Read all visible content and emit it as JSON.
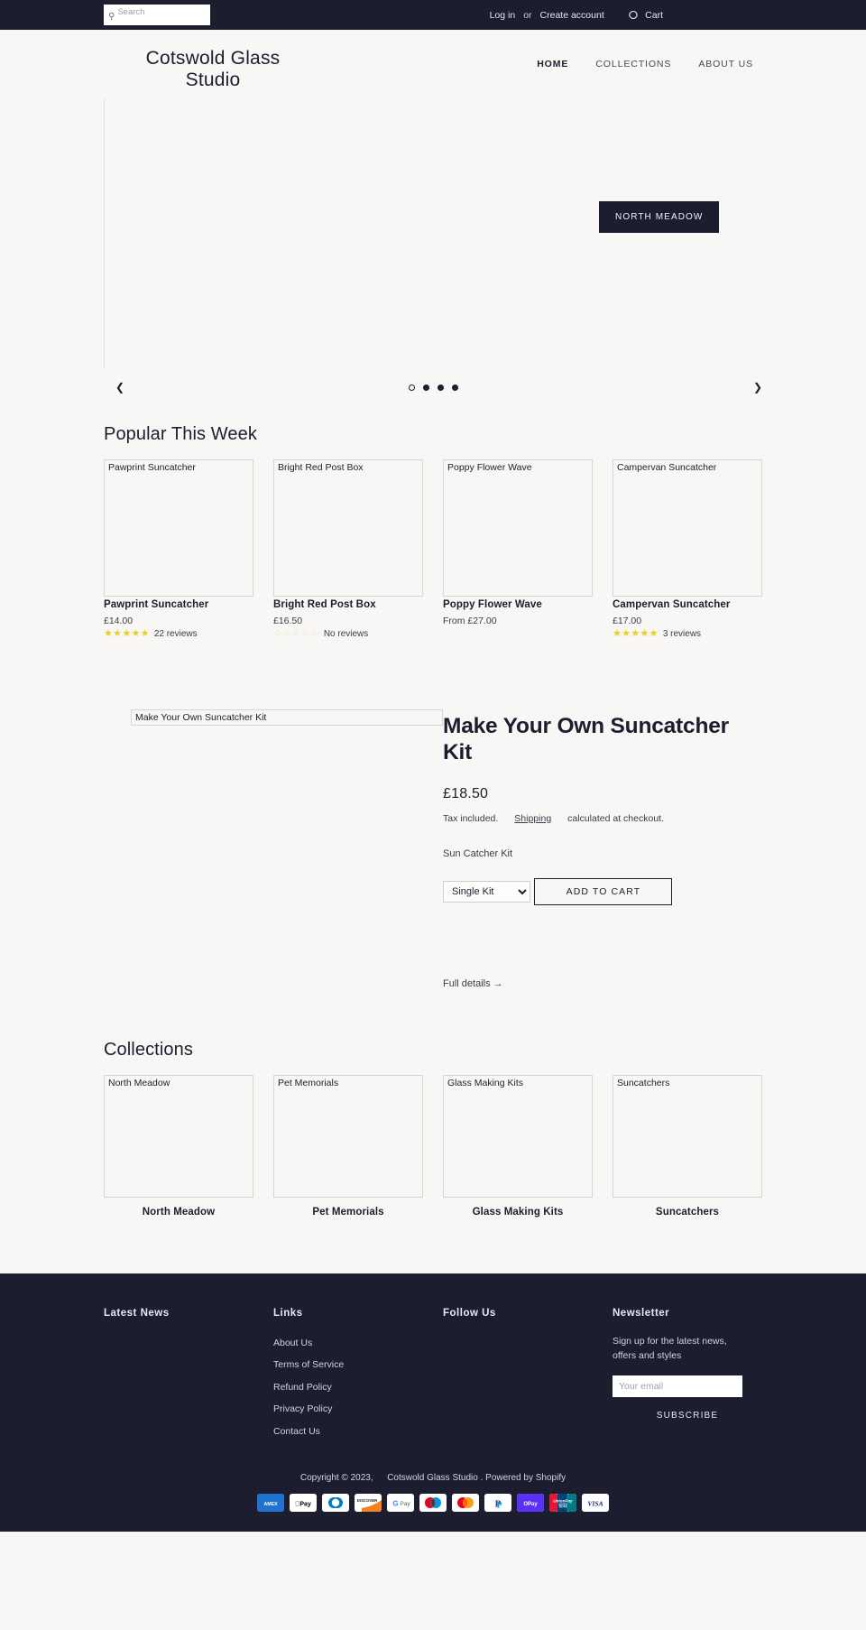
{
  "topbar": {
    "search_placeholder": "Search",
    "search_value": "",
    "search_icon": "search-icon",
    "login": "Log in",
    "or": "or",
    "create_account": "Create account",
    "cart": "Cart",
    "cart_icon": "cart-icon"
  },
  "header": {
    "brand": "Cotswold Glass Studio",
    "nav": [
      {
        "label": "HOME",
        "active": true
      },
      {
        "label": "COLLECTIONS",
        "active": false
      },
      {
        "label": "ABOUT US",
        "active": false
      }
    ]
  },
  "slideshow": {
    "cta_label": "NORTH MEADOW",
    "prev_icon": "chevron-left-icon",
    "prev_glyph": "❮",
    "next_icon": "chevron-right-icon",
    "next_glyph": "❯",
    "dots": 4,
    "active_dot": 0
  },
  "popular": {
    "title": "Popular This Week",
    "products": [
      {
        "alt": "Pawprint Suncatcher",
        "title": "Pawprint Suncatcher",
        "price": "£14.00",
        "stars": "★★★★★",
        "rating_filled": true,
        "reviews": "22 reviews",
        "has_rating": true
      },
      {
        "alt": "Bright Red Post Box",
        "title": "Bright Red Post Box",
        "price": "£16.50",
        "stars": "☆☆☆☆☆",
        "rating_filled": false,
        "reviews": "No reviews",
        "has_rating": true
      },
      {
        "alt": "Poppy Flower Wave",
        "title": "Poppy Flower Wave",
        "price": "From £27.00",
        "stars": "",
        "rating_filled": false,
        "reviews": "",
        "has_rating": false
      },
      {
        "alt": "Campervan Suncatcher",
        "title": "Campervan Suncatcher",
        "price": "£17.00",
        "stars": "★★★★★",
        "rating_filled": true,
        "reviews": "3 reviews",
        "has_rating": true
      }
    ]
  },
  "featured": {
    "image_alt": "Make Your Own Suncatcher Kit",
    "title": "Make Your Own Suncatcher Kit",
    "price": "£18.50",
    "tax_note": "Tax included.",
    "shipping_link": "Shipping",
    "shipping_note": "calculated at checkout.",
    "variant_label": "Sun Catcher Kit",
    "variant_selected": "Single Kit",
    "variant_options": [
      "Single Kit"
    ],
    "add_to_cart": "ADD TO CART",
    "full_details": "Full details →"
  },
  "collections": {
    "title": "Collections",
    "items": [
      {
        "alt": "North Meadow",
        "title": "North Meadow"
      },
      {
        "alt": "Pet Memorials",
        "title": "Pet Memorials"
      },
      {
        "alt": "Glass Making Kits",
        "title": "Glass Making Kits"
      },
      {
        "alt": "Suncatchers",
        "title": "Suncatchers"
      }
    ]
  },
  "footer": {
    "latest_news_heading": "Latest News",
    "links_heading": "Links",
    "links": [
      "About Us",
      "Terms of Service",
      "Refund Policy",
      "Privacy Policy",
      "Contact Us"
    ],
    "follow_heading": "Follow Us",
    "newsletter_heading": "Newsletter",
    "newsletter_text": "Sign up for the latest news, offers and styles",
    "email_placeholder": "Your email",
    "email_value": "",
    "subscribe": "SUBSCRIBE",
    "copyright_prefix": "Copyright © 2023,",
    "copyright_store": "Cotswold Glass Studio",
    "copyright_suffix": ". Powered by Shopify",
    "payment_methods": [
      "american-express",
      "apple-pay",
      "diners-club",
      "discover",
      "google-pay",
      "maestro",
      "mastercard",
      "paypal",
      "shop-pay",
      "union-pay",
      "visa"
    ]
  },
  "colors": {
    "dark": "#1c1d2e",
    "page_bg": "#f8f7f5",
    "star_gold": "#e8d020"
  }
}
